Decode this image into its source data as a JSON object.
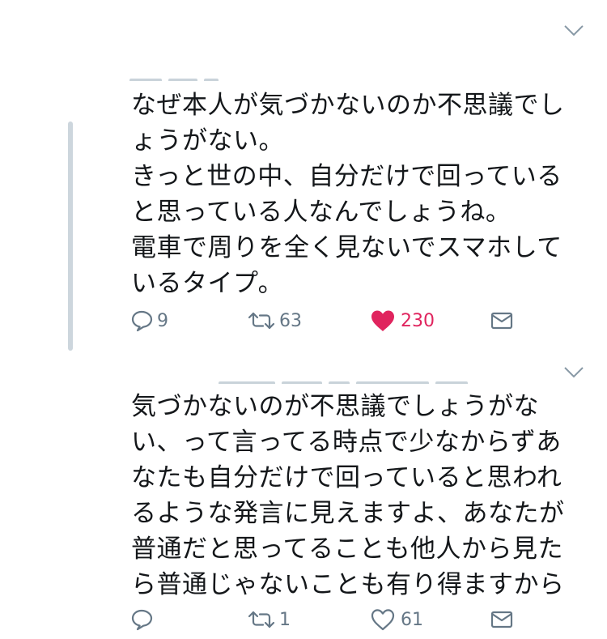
{
  "tweets": [
    {
      "text": "なぜ本人が気づかないのか不思議でし\nょうがない。\nきっと世の中、自分だけで回っている\nと思っている人なんでしょうね。\n電車で周りを全く見ないでスマホして\nいるタイプ。",
      "replies": "9",
      "retweets": "63",
      "likes": "230",
      "liked": true
    },
    {
      "text": "気づかないのが不思議でしょうがな\nい、って言ってる時点で少なからずあ\nなたも自分だけで回っていると思われ\nるような発言に見えますよ、あなたが\n普通だと思ってることも他人から見た\nら普通じゃないことも有り得ますから",
      "replies": "",
      "retweets": "1",
      "likes": "61",
      "liked": false
    }
  ],
  "colors": {
    "text": "#14171a",
    "icon": "#657786",
    "like_active": "#e0245e",
    "thread_line": "#cdd6dd"
  },
  "icons": [
    "reply-icon",
    "retweet-icon",
    "heart-icon",
    "dm-envelope-icon",
    "chevron-down-icon"
  ]
}
